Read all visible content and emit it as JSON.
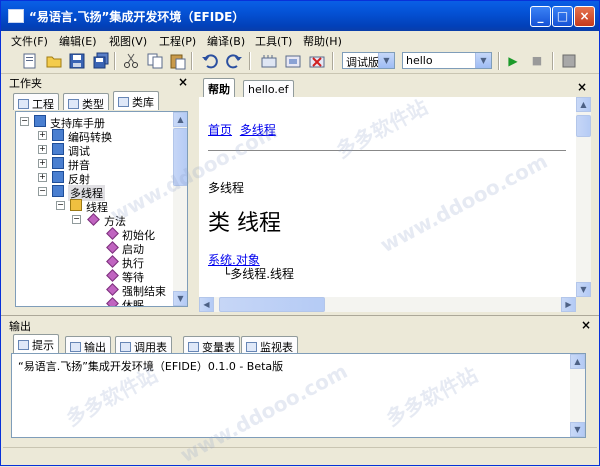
{
  "window": {
    "title": "“易语言.飞扬”集成开发环境（EFIDE）",
    "minimize": "_",
    "maximize": "□",
    "close": "×"
  },
  "menu": [
    "文件(F)",
    "编辑(E)",
    "视图(V)",
    "工程(P)",
    "编译(B)",
    "工具(T)",
    "帮助(H)"
  ],
  "toolbar": {
    "build_mode": "调试版",
    "target": "hello",
    "run_glyph": "▶",
    "stop_glyph": "■"
  },
  "workspace": {
    "title": "工作夹",
    "close": "×",
    "tabs": [
      "工程",
      "类型",
      "类库"
    ],
    "tree": [
      {
        "label": "支持库手册",
        "level": 0,
        "toggle": "−"
      },
      {
        "label": "编码转换",
        "level": 1,
        "toggle": "+"
      },
      {
        "label": "调试",
        "level": 1,
        "toggle": "+"
      },
      {
        "label": "拼音",
        "level": 1,
        "toggle": "+"
      },
      {
        "label": "反射",
        "level": 1,
        "toggle": "+"
      },
      {
        "label": "多线程",
        "level": 1,
        "toggle": "−"
      },
      {
        "label": "线程",
        "level": 2,
        "toggle": "−"
      },
      {
        "label": "方法",
        "level": 3,
        "toggle": "−"
      },
      {
        "label": "初始化",
        "level": 4,
        "toggle": ""
      },
      {
        "label": "启动",
        "level": 4,
        "toggle": ""
      },
      {
        "label": "执行",
        "level": 4,
        "toggle": ""
      },
      {
        "label": "等待",
        "level": 4,
        "toggle": ""
      },
      {
        "label": "强制结束",
        "level": 4,
        "toggle": ""
      },
      {
        "label": "休眠",
        "level": 4,
        "toggle": ""
      }
    ]
  },
  "editor": {
    "tabs": [
      "帮助",
      "hello.ef"
    ],
    "close": "×",
    "nav_home": "首页",
    "nav_crumb": "多线程",
    "section": "多线程",
    "heading": "类 线程",
    "base_link": "系统.对象",
    "inherit": "└多线程.线程"
  },
  "output": {
    "title": "输出",
    "close": "×",
    "tabs": [
      "提示",
      "输出",
      "调用表",
      "变量表",
      "监视表"
    ],
    "text": "“易语言.飞扬”集成开发环境（EFIDE）0.1.0 - Beta版"
  },
  "watermark": [
    "多多软件站",
    "www.ddooo.com"
  ]
}
